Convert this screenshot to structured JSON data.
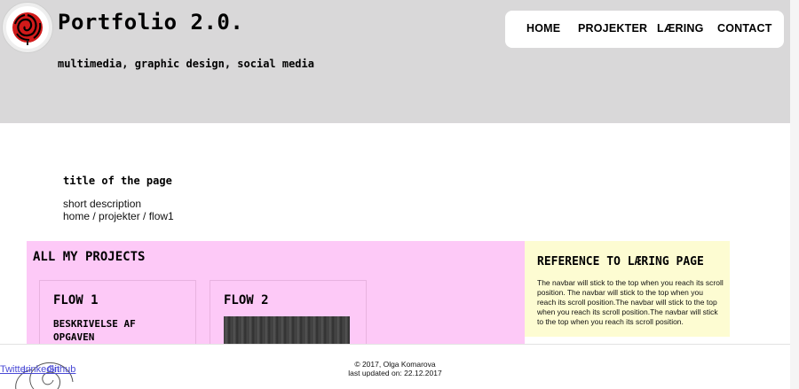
{
  "header": {
    "site_title": "Portfolio 2.0.",
    "tagline": "multimedia, graphic design, social media",
    "logo_icon": "rose-icon"
  },
  "nav": {
    "items": [
      {
        "label": "HOME"
      },
      {
        "label": "PROJEKTER"
      },
      {
        "label": "LÆRING"
      },
      {
        "label": "CONTACT"
      }
    ]
  },
  "page": {
    "title": "title of the page",
    "description": "short description",
    "breadcrumb": "home / projekter / flow1"
  },
  "projects": {
    "heading": "ALL MY PROJECTS",
    "cards": [
      {
        "title": "FLOW 1",
        "description": "BESKRIVELSE AF OPGAVEN"
      },
      {
        "title": "FLOW 2"
      }
    ]
  },
  "aside": {
    "heading": "REFERENCE TO LÆRING PAGE",
    "text": "The navbar will stick to the top when you reach its scroll position. The navbar will stick to the top when you reach its scroll position.The navbar will stick to the top when you reach its scroll position.The navbar will stick to the top when you reach its scroll position."
  },
  "footer": {
    "copyright": "© 2017, Olga Komarova",
    "updated": "last updated on: 22.12.2017",
    "social": [
      {
        "label": "Twitter"
      },
      {
        "label": "Linkedin"
      },
      {
        "label": "Github"
      }
    ]
  },
  "colors": {
    "header_bg": "#d9d8d9",
    "projects_bg": "#fdc9f7",
    "aside_bg": "#fdfcd2",
    "link": "#4a4ad6",
    "logo_rose": "#d11a1a"
  }
}
